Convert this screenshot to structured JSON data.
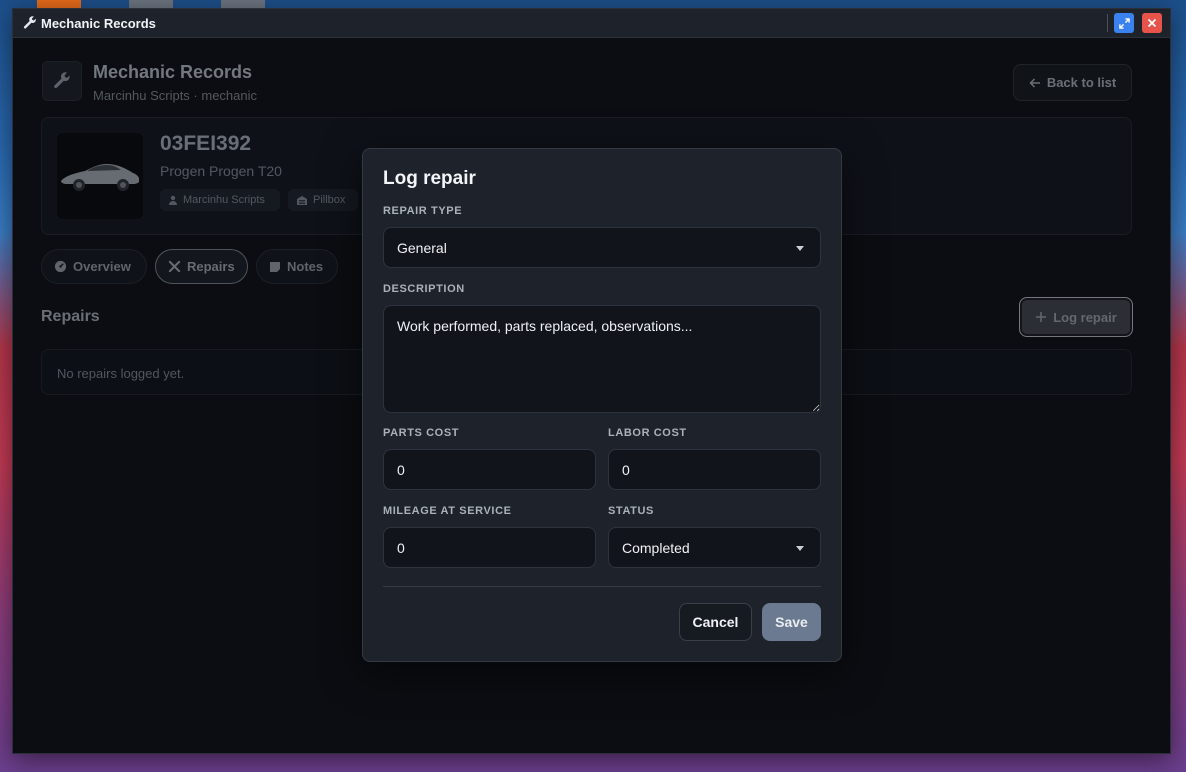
{
  "window": {
    "title": "Mechanic Records"
  },
  "header": {
    "app_name": "Mechanic Records",
    "subtitle": "Marcinhu Scripts · mechanic",
    "back_label": "Back to list"
  },
  "vehicle": {
    "plate": "03FEI392",
    "model": "Progen Progen T20",
    "owner": "Marcinhu Scripts",
    "garage": "Pillbox"
  },
  "tabs": [
    {
      "label": "Overview",
      "icon": "dashboard-icon"
    },
    {
      "label": "Repairs",
      "icon": "tools-icon"
    },
    {
      "label": "Notes",
      "icon": "note-icon"
    }
  ],
  "repairs": {
    "title": "Repairs",
    "log_button": "Log repair",
    "empty_text": "No repairs logged yet."
  },
  "modal": {
    "title": "Log repair",
    "repair_type_label": "REPAIR TYPE",
    "repair_type_value": "General",
    "description_label": "DESCRIPTION",
    "description_placeholder": "Work performed, parts replaced, observations...",
    "parts_cost_label": "PARTS COST",
    "parts_cost_value": "0",
    "labor_cost_label": "LABOR COST",
    "labor_cost_value": "0",
    "mileage_label": "MILEAGE AT SERVICE",
    "mileage_value": "0",
    "status_label": "STATUS",
    "status_value": "Completed",
    "cancel_label": "Cancel",
    "save_label": "Save"
  },
  "colors": {
    "accent_maximize": "#3a82f0",
    "accent_close": "#e5534b",
    "save_button": "#6b7a90"
  }
}
